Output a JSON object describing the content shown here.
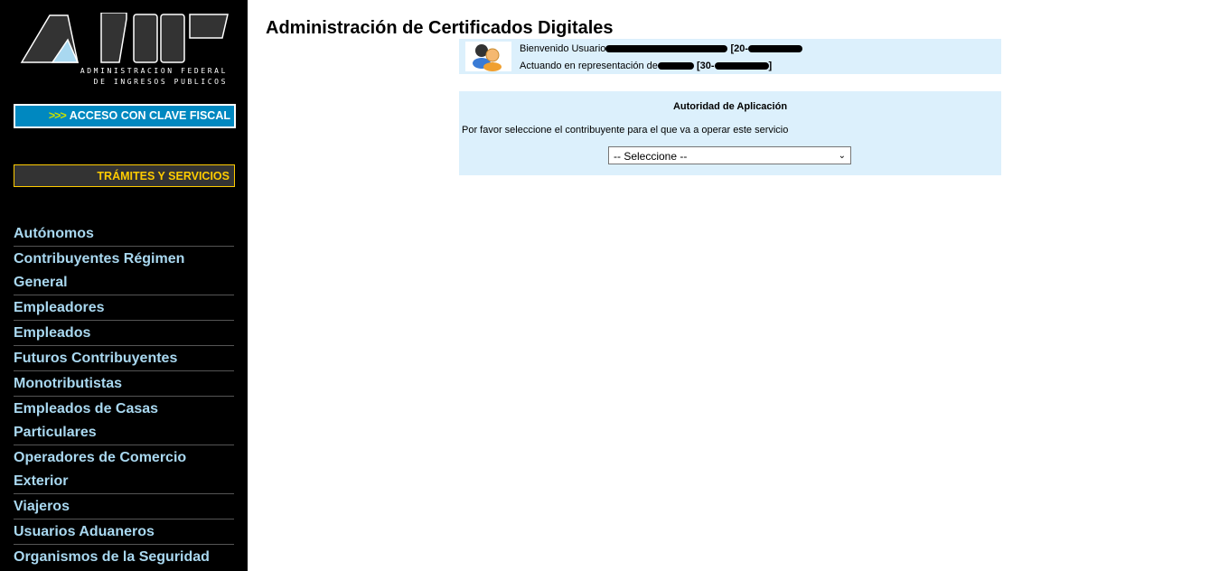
{
  "sidebar": {
    "logo_text": "AFIP",
    "logo_sub1": "ADMINISTRACION FEDERAL",
    "logo_sub2": "DE INGRESOS PUBLICOS",
    "acceso_arrows": ">>>",
    "acceso_label": "ACCESO CON CLAVE FISCAL",
    "tramites_label": "TRÁMITES Y SERVICIOS",
    "items": [
      {
        "label": "Autónomos"
      },
      {
        "label": "Contribuyentes Régimen General"
      },
      {
        "label": "Empleadores"
      },
      {
        "label": "Empleados"
      },
      {
        "label": "Futuros Contribuyentes"
      },
      {
        "label": "Monotributistas"
      },
      {
        "label": "Empleados de Casas Particulares"
      },
      {
        "label": "Operadores de Comercio Exterior"
      },
      {
        "label": "Viajeros"
      },
      {
        "label": "Usuarios Aduaneros"
      },
      {
        "label": "Organismos de la Seguridad Social"
      }
    ]
  },
  "main": {
    "title": "Administración de Certificados Digitales",
    "user": {
      "welcome": "Bienvenido Usuario",
      "cuit_prefix": "[20-",
      "representing": "Actuando en representación de",
      "rep_cuit_prefix": "[30-",
      "rep_cuit_suffix": "]"
    },
    "autoridad": {
      "title": "Autoridad de Aplicación",
      "message": "Por favor seleccione el contribuyente para el que va a operar este servicio",
      "select_value": "-- Seleccione --"
    }
  },
  "colors": {
    "sidebar_bg": "#000000",
    "nav_text": "#a9d8f0",
    "acceso_bg": "#0088c0",
    "tramites_text": "#ffcc00",
    "panel_bg": "#dcf0fc"
  }
}
